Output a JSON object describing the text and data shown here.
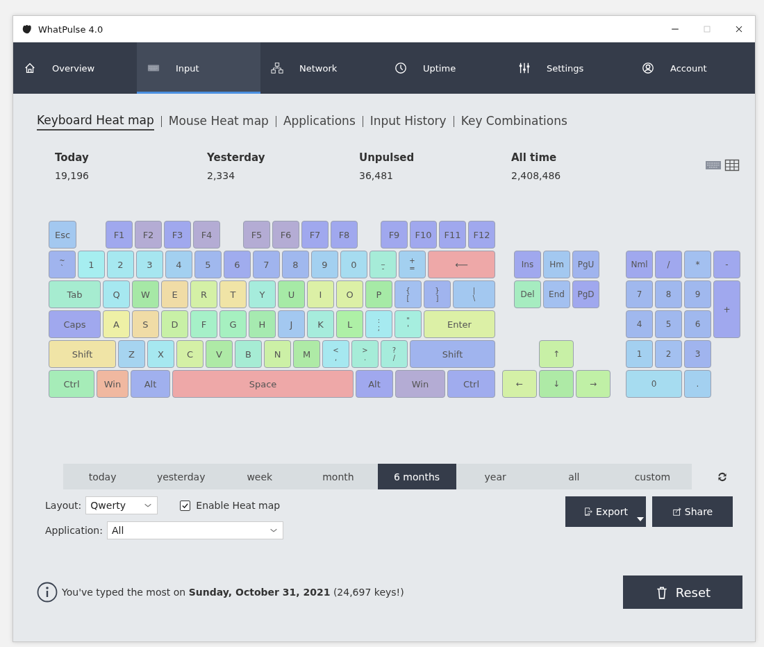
{
  "window": {
    "title": "WhatPulse 4.0"
  },
  "nav": [
    {
      "label": "Overview",
      "kind": "home",
      "selected": false
    },
    {
      "label": "Input",
      "kind": "keyboard",
      "selected": true
    },
    {
      "label": "Network",
      "kind": "network",
      "selected": false
    },
    {
      "label": "Uptime",
      "kind": "clock",
      "selected": false
    },
    {
      "label": "Settings",
      "kind": "sliders",
      "selected": false
    },
    {
      "label": "Account",
      "kind": "user",
      "selected": false
    }
  ],
  "subtabs": [
    {
      "label": "Keyboard Heat map",
      "selected": true
    },
    {
      "label": "Mouse Heat map",
      "selected": false
    },
    {
      "label": "Applications",
      "selected": false
    },
    {
      "label": "Input History",
      "selected": false
    },
    {
      "label": "Key Combinations",
      "selected": false
    }
  ],
  "stats": [
    {
      "label": "Today",
      "value": "19,196"
    },
    {
      "label": "Yesterday",
      "value": "2,334"
    },
    {
      "label": "Unpulsed",
      "value": "36,481"
    },
    {
      "label": "All time",
      "value": "2,408,486"
    }
  ],
  "keyboard": {
    "main_rows": [
      [
        {
          "label": "Esc",
          "color": "#a3c8f0"
        },
        {
          "label": "F1",
          "color": "#a0a8ee"
        },
        {
          "label": "F2",
          "color": "#b4acd4"
        },
        {
          "label": "F3",
          "color": "#a0a8ee"
        },
        {
          "label": "F4",
          "color": "#b4acd4"
        },
        {
          "label": "F5",
          "color": "#b4acd4"
        },
        {
          "label": "F6",
          "color": "#b4acd4"
        },
        {
          "label": "F7",
          "color": "#a0a8ee"
        },
        {
          "label": "F8",
          "color": "#a0a8ee"
        },
        {
          "label": "F9",
          "color": "#a0a8ee"
        },
        {
          "label": "F10",
          "color": "#a0a8ee"
        },
        {
          "label": "F11",
          "color": "#a0a8ee"
        },
        {
          "label": "F12",
          "color": "#a0a8ee"
        }
      ],
      [
        {
          "upper": "~",
          "lower": "`",
          "color": "#a0b4ee"
        },
        {
          "label": "1",
          "color": "#a6eef0"
        },
        {
          "label": "2",
          "color": "#a6e8f0"
        },
        {
          "label": "3",
          "color": "#a6e6f0"
        },
        {
          "label": "4",
          "color": "#a3d0f0"
        },
        {
          "label": "5",
          "color": "#a0b8ee"
        },
        {
          "label": "6",
          "color": "#a0acee"
        },
        {
          "label": "7",
          "color": "#a0b4ee"
        },
        {
          "label": "8",
          "color": "#a0b8ee"
        },
        {
          "label": "9",
          "color": "#a3d0f0"
        },
        {
          "label": "0",
          "color": "#a6dcf0"
        },
        {
          "upper": "_",
          "lower": "-",
          "color": "#a6ecd8"
        },
        {
          "upper": "+",
          "lower": "=",
          "color": "#a3d0f0"
        },
        {
          "label": "⟵",
          "color": "#eea8a8"
        }
      ],
      [
        {
          "label": "Tab",
          "color": "#a6ecd0"
        },
        {
          "label": "Q",
          "color": "#a6e8f0"
        },
        {
          "label": "W",
          "color": "#a6e8a6"
        },
        {
          "label": "E",
          "color": "#f0dca6"
        },
        {
          "label": "R",
          "color": "#d4f0a6"
        },
        {
          "label": "T",
          "color": "#f0e4a6"
        },
        {
          "label": "Y",
          "color": "#a6ecdc"
        },
        {
          "label": "U",
          "color": "#a6eaa6"
        },
        {
          "label": "I",
          "color": "#dcf0a6"
        },
        {
          "label": "O",
          "color": "#dcf0a6"
        },
        {
          "label": "P",
          "color": "#a6eaa6"
        },
        {
          "upper": "{",
          "lower": "[",
          "color": "#a3c0f0"
        },
        {
          "upper": "}",
          "lower": "]",
          "color": "#a0b4ee"
        },
        {
          "upper": "|",
          "lower": "\\",
          "color": "#a3c8f0"
        }
      ],
      [
        {
          "label": "Caps",
          "color": "#a0a8ee"
        },
        {
          "label": "A",
          "color": "#eef0a6"
        },
        {
          "label": "S",
          "color": "#f0dca6"
        },
        {
          "label": "D",
          "color": "#c8f0a6"
        },
        {
          "label": "F",
          "color": "#a6f0c8"
        },
        {
          "label": "G",
          "color": "#a6f0c0"
        },
        {
          "label": "H",
          "color": "#a6eab0"
        },
        {
          "label": "J",
          "color": "#a3c8f0"
        },
        {
          "label": "K",
          "color": "#a6ecdc"
        },
        {
          "label": "L",
          "color": "#aef0a6"
        },
        {
          "upper": ":",
          "lower": ";",
          "color": "#a6eaf0"
        },
        {
          "upper": "\"",
          "lower": "'",
          "color": "#a6eedf"
        },
        {
          "label": "Enter",
          "color": "#dcf0a6"
        }
      ],
      [
        {
          "label": "Shift",
          "color": "#f0e4a6"
        },
        {
          "label": "Z",
          "color": "#a6d4f0"
        },
        {
          "label": "X",
          "color": "#a6e8f0"
        },
        {
          "label": "C",
          "color": "#d4f0a6"
        },
        {
          "label": "V",
          "color": "#aeeaa6"
        },
        {
          "label": "B",
          "color": "#a6ecd4"
        },
        {
          "label": "N",
          "color": "#ccf0a6"
        },
        {
          "label": "M",
          "color": "#aeeaa6"
        },
        {
          "upper": "<",
          "lower": ",",
          "color": "#a6e8f0"
        },
        {
          "upper": ">",
          "lower": ".",
          "color": "#a6ecd8"
        },
        {
          "upper": "?",
          "lower": "/",
          "color": "#a6ecdc"
        },
        {
          "label": "Shift",
          "color": "#a0b4ee"
        }
      ],
      [
        {
          "label": "Ctrl",
          "color": "#a6ecb8"
        },
        {
          "label": "Win",
          "color": "#f0b8a0"
        },
        {
          "label": "Alt",
          "color": "#a0b0ee"
        },
        {
          "label": "Space",
          "color": "#eea8a8"
        },
        {
          "label": "Alt",
          "color": "#a0a8ee"
        },
        {
          "label": "Win",
          "color": "#b4acd4"
        },
        {
          "label": "Ctrl",
          "color": "#a0acee"
        }
      ]
    ],
    "navigation": [
      {
        "label": "Ins",
        "color": "#a0a8ee"
      },
      {
        "label": "Hm",
        "color": "#a3c8f0"
      },
      {
        "label": "PgU",
        "color": "#a0b4ee"
      },
      {
        "label": "Del",
        "color": "#a6ecc0"
      },
      {
        "label": "End",
        "color": "#a3c0f0"
      },
      {
        "label": "PgD",
        "color": "#a0a8ee"
      }
    ],
    "arrows": [
      {
        "label": "↑",
        "color": "#c8f0a6"
      },
      {
        "label": "←",
        "color": "#d4f0a6"
      },
      {
        "label": "↓",
        "color": "#aeeaa6"
      },
      {
        "label": "→",
        "color": "#c0f0a6"
      }
    ],
    "numpad": [
      {
        "label": "Nml",
        "color": "#a0a8ee"
      },
      {
        "label": "/",
        "color": "#a0a8ee"
      },
      {
        "label": "*",
        "color": "#a3c0f0"
      },
      {
        "label": "-",
        "color": "#a0a8ee"
      },
      {
        "label": "7",
        "color": "#a0b8ee"
      },
      {
        "label": "8",
        "color": "#a0b8ee"
      },
      {
        "label": "9",
        "color": "#a0b8ee"
      },
      {
        "label": "+",
        "color": "#a0a8ee"
      },
      {
        "label": "4",
        "color": "#a0b8ee"
      },
      {
        "label": "5",
        "color": "#a0b8ee"
      },
      {
        "label": "6",
        "color": "#a0b8ee"
      },
      {
        "label": "1",
        "color": "#a3d0f0"
      },
      {
        "label": "2",
        "color": "#a3c0f0"
      },
      {
        "label": "3",
        "color": "#a0b4ee"
      },
      {
        "label": "0",
        "color": "#a6dcf0"
      },
      {
        "label": ".",
        "color": "#a3d0f0"
      }
    ]
  },
  "ranges": [
    {
      "label": "today",
      "selected": false
    },
    {
      "label": "yesterday",
      "selected": false
    },
    {
      "label": "week",
      "selected": false
    },
    {
      "label": "month",
      "selected": false
    },
    {
      "label": "6 months",
      "selected": true
    },
    {
      "label": "year",
      "selected": false
    },
    {
      "label": "all",
      "selected": false
    },
    {
      "label": "custom",
      "selected": false
    }
  ],
  "layout": {
    "label": "Layout:",
    "value": "Qwerty"
  },
  "heatmap_toggle": {
    "label": "Enable Heat map",
    "checked": true
  },
  "buttons": {
    "export": "Export",
    "share": "Share",
    "reset": "Reset"
  },
  "application": {
    "label": "Application:",
    "value": "All"
  },
  "info": "You've typed the most on **Sunday, October 31, 2021** (24,697 keys!)"
}
